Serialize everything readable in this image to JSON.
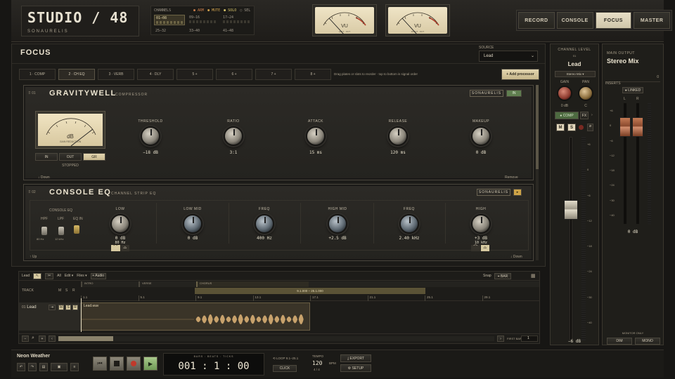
{
  "header": {
    "title": "STUDIO / 48",
    "subtitle": "SONAURELIS",
    "channels_label": "CHANNELS",
    "arm": "ARM",
    "mute": "MUTE",
    "solo": "SOLO",
    "sel": "SEL",
    "banks": [
      "01–08",
      "09–16",
      "17–24",
      "25–32",
      "33–40",
      "41–48"
    ],
    "vu_left": {
      "label": "VU",
      "sub": "LEFT · OUT"
    },
    "vu_right": {
      "label": "VU",
      "sub": "RIGHT · OUT"
    },
    "tabs": [
      "RECORD",
      "CONSOLE",
      "FOCUS",
      "MASTER"
    ],
    "active_tab": "FOCUS"
  },
  "focus": {
    "title": "FOCUS",
    "source_label": "SOURCE",
    "source_value": "Lead",
    "slots": [
      "1 · COMP",
      "2 · CH EQ",
      "3 · VERB",
      "4 · DLY",
      "5 +",
      "6 +",
      "7 +",
      "8 +"
    ],
    "hint": "Drag plates or slots to reorder · top to bottom is signal order",
    "add_processor": "+ Add processor"
  },
  "comp": {
    "num": "01",
    "name": "GRAVITYWELL",
    "type": "COMPRESSOR",
    "brand": "SONAURELIS",
    "in": "IN",
    "meter_label": "dB",
    "meter_sub": "GAIN REDUCTION",
    "modes": [
      "IN",
      "OUT",
      "GR"
    ],
    "status": "STOPPED",
    "knobs": [
      {
        "label": "THRESHOLD",
        "value": "−18",
        "unit": "dB"
      },
      {
        "label": "RATIO",
        "value": "3:1",
        "unit": ""
      },
      {
        "label": "ATTACK",
        "value": "15",
        "unit": "ms"
      },
      {
        "label": "RELEASE",
        "value": "120",
        "unit": "ms"
      },
      {
        "label": "MAKEUP",
        "value": "0",
        "unit": "dB"
      }
    ],
    "down": "↓ Down",
    "remove": "Remove"
  },
  "eq": {
    "num": "02",
    "name": "CONSOLE EQ",
    "type": "CHANNEL STRIP EQ",
    "brand": "SONAURELIS",
    "section": "CONSOLE EQ",
    "hpf": "HPF",
    "lpf": "LPF",
    "eqin": "EQ IN",
    "hpf_val": "80 Hz",
    "lpf_val": "12 kHz",
    "knobs": [
      {
        "label": "LOW",
        "value": "0",
        "unit": "dB",
        "sub": "80 Hz"
      },
      {
        "label": "LOW MID",
        "value": "0",
        "unit": "dB"
      },
      {
        "label": "FREQ",
        "value": "400",
        "unit": "Hz"
      },
      {
        "label": "HIGH MID",
        "value": "+2.5",
        "unit": "dB"
      },
      {
        "label": "FREQ",
        "value": "2.40",
        "unit": "kHz"
      },
      {
        "label": "HIGH",
        "value": "+3",
        "unit": "dB",
        "sub": "10 kHz"
      }
    ],
    "up": "↑ Up",
    "down": "↓ Down"
  },
  "arrange": {
    "track": "Lead",
    "all": "All",
    "edit": "Edit ▾",
    "files": "Files ▾",
    "audio": "+ Audio",
    "snap": "Snap",
    "bar": "⌖ BAR",
    "header": "TRACK",
    "m": "M",
    "s": "S",
    "r": "R",
    "sections": [
      "INTRO",
      "VERSE",
      "CHORUS"
    ],
    "loop_range": "9.1.000 – 25.1.000",
    "ruler": [
      "1.1",
      "5.1",
      "9.1",
      "13.1",
      "17.1",
      "21.1",
      "25.1",
      "29.1"
    ],
    "track_num": "01",
    "clip": "Lead.wav",
    "first_bar_label": "FIRST BAR",
    "first_bar": "1"
  },
  "strip": {
    "label": "CHANNEL LEVEL",
    "num": "01",
    "name": "Lead",
    "bus": "Stereo Mix",
    "gain": "GAIN",
    "pan": "PAN",
    "gain_val": "0 dB",
    "pan_val": "C",
    "comp": "● COMP",
    "fx": "FX",
    "m": "M",
    "s": "S",
    "level": "−6 dB",
    "scale": [
      "+6",
      "0",
      "−6",
      "−12",
      "−18",
      "−24",
      "−30",
      "−40"
    ]
  },
  "output": {
    "label": "MAIN OUTPUT",
    "name": "Stereo Mix",
    "inserts": "INSERTS",
    "inserts_count": "0",
    "linked": "● LINKED",
    "l": "L",
    "r": "R",
    "value": "0 dB",
    "monitor": "MONITOR ONLY",
    "dim": "DIM",
    "mono": "MONO",
    "scale": [
      "+6",
      "0",
      "−6",
      "−12",
      "−18",
      "−24",
      "−30",
      "−40"
    ]
  },
  "footer": {
    "song": "Neon Weather",
    "timecode_label": "BARS : BEATS : TICKS",
    "bars": "001",
    "beats": "1",
    "ticks": "00",
    "loop": "LOOP 9.1–25.1",
    "click": "CLICK",
    "tempo_label": "TEMPO",
    "tempo": "120",
    "bpm": "BPM",
    "sig": "4 / 4",
    "export": "⤓ EXPORT",
    "setup": "⚙ SETUP"
  },
  "colors": {
    "accent": "#e6dcc0",
    "record": "#c0392b",
    "play": "#8ab36a",
    "meter_green": "#6f9a55",
    "clip_wave": "#c8a26c"
  }
}
